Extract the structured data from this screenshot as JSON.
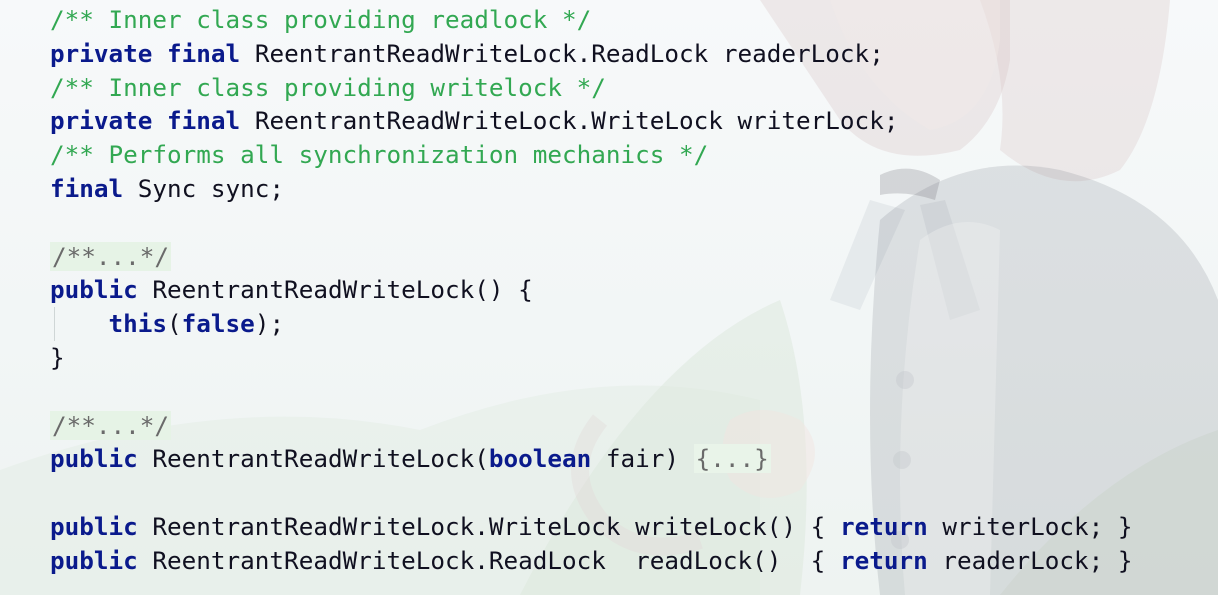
{
  "editor": {
    "lines": [
      [
        {
          "t": "/** Inner class providing readlock */",
          "c": "cm"
        }
      ],
      [
        {
          "t": "private",
          "c": "kw"
        },
        {
          "t": " ",
          "c": ""
        },
        {
          "t": "final",
          "c": "kw"
        },
        {
          "t": " ReentrantReadWriteLock.ReadLock readerLock;",
          "c": ""
        }
      ],
      [
        {
          "t": "/** Inner class providing writelock */",
          "c": "cm"
        }
      ],
      [
        {
          "t": "private",
          "c": "kw"
        },
        {
          "t": " ",
          "c": ""
        },
        {
          "t": "final",
          "c": "kw"
        },
        {
          "t": " ReentrantReadWriteLock.WriteLock writerLock;",
          "c": ""
        }
      ],
      [
        {
          "t": "/** Performs all synchronization mechanics */",
          "c": "cm"
        }
      ],
      [
        {
          "t": "final",
          "c": "kw"
        },
        {
          "t": " Sync sync;",
          "c": ""
        }
      ],
      [],
      [
        {
          "t": "/**...*/",
          "c": "fold-cm"
        }
      ],
      [
        {
          "t": "public",
          "c": "kw"
        },
        {
          "t": " ReentrantReadWriteLock() {",
          "c": ""
        }
      ],
      [
        {
          "t": "    ",
          "c": "",
          "guide": true
        },
        {
          "t": "this",
          "c": "kw"
        },
        {
          "t": "(",
          "c": ""
        },
        {
          "t": "false",
          "c": "kw"
        },
        {
          "t": ");",
          "c": ""
        }
      ],
      [
        {
          "t": "}",
          "c": ""
        }
      ],
      [],
      [
        {
          "t": "/**...*/",
          "c": "fold-cm"
        }
      ],
      [
        {
          "t": "public",
          "c": "kw"
        },
        {
          "t": " ReentrantReadWriteLock(",
          "c": ""
        },
        {
          "t": "boolean",
          "c": "kw"
        },
        {
          "t": " fair) ",
          "c": ""
        },
        {
          "t": "{...}",
          "c": "fold-body"
        }
      ],
      [],
      [
        {
          "t": "public",
          "c": "kw"
        },
        {
          "t": " ReentrantReadWriteLock.WriteLock writeLock() { ",
          "c": ""
        },
        {
          "t": "return",
          "c": "kw"
        },
        {
          "t": " writerLock; }",
          "c": ""
        }
      ],
      [
        {
          "t": "public",
          "c": "kw"
        },
        {
          "t": " ReentrantReadWriteLock.ReadLock  readLock()  { ",
          "c": ""
        },
        {
          "t": "return",
          "c": "kw"
        },
        {
          "t": " readerLock; }",
          "c": ""
        }
      ]
    ]
  },
  "colors": {
    "keyword": "#0a1a8c",
    "comment": "#32a852",
    "text": "#101020",
    "fold_background": "#e6f3e6"
  }
}
